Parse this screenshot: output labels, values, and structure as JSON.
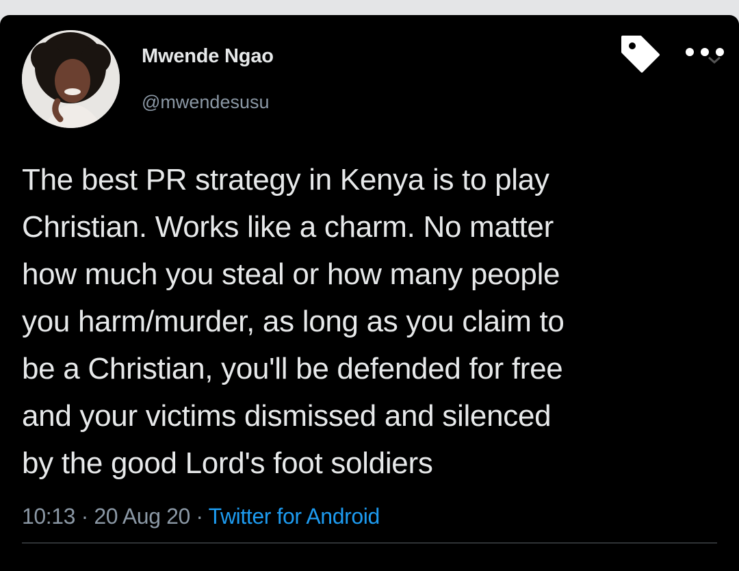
{
  "tweet": {
    "author": {
      "display_name": "Mwende Ngao",
      "handle": "@mwendesusu",
      "avatar_icon": "profile-photo"
    },
    "text": "The best PR strategy in Kenya is to play\nChristian. Works like a charm. No matter\nhow much you steal or how many people\nyou harm/murder, as long as you claim to\nbe a Christian, you'll be defended for free\nand your victims dismissed and silenced\nby the good Lord's foot soldiers",
    "time": "10:13",
    "separator": " · ",
    "date": "20 Aug 20",
    "source": "Twitter for Android",
    "icons": {
      "tag": "tag-icon",
      "more": "more-options-icon"
    }
  },
  "colors": {
    "background": "#000000",
    "text_primary": "#e7e9ea",
    "text_secondary": "#8b98a5",
    "link": "#1d9bf0",
    "divider": "#2f3336",
    "page_border": "#e4e5e7"
  }
}
